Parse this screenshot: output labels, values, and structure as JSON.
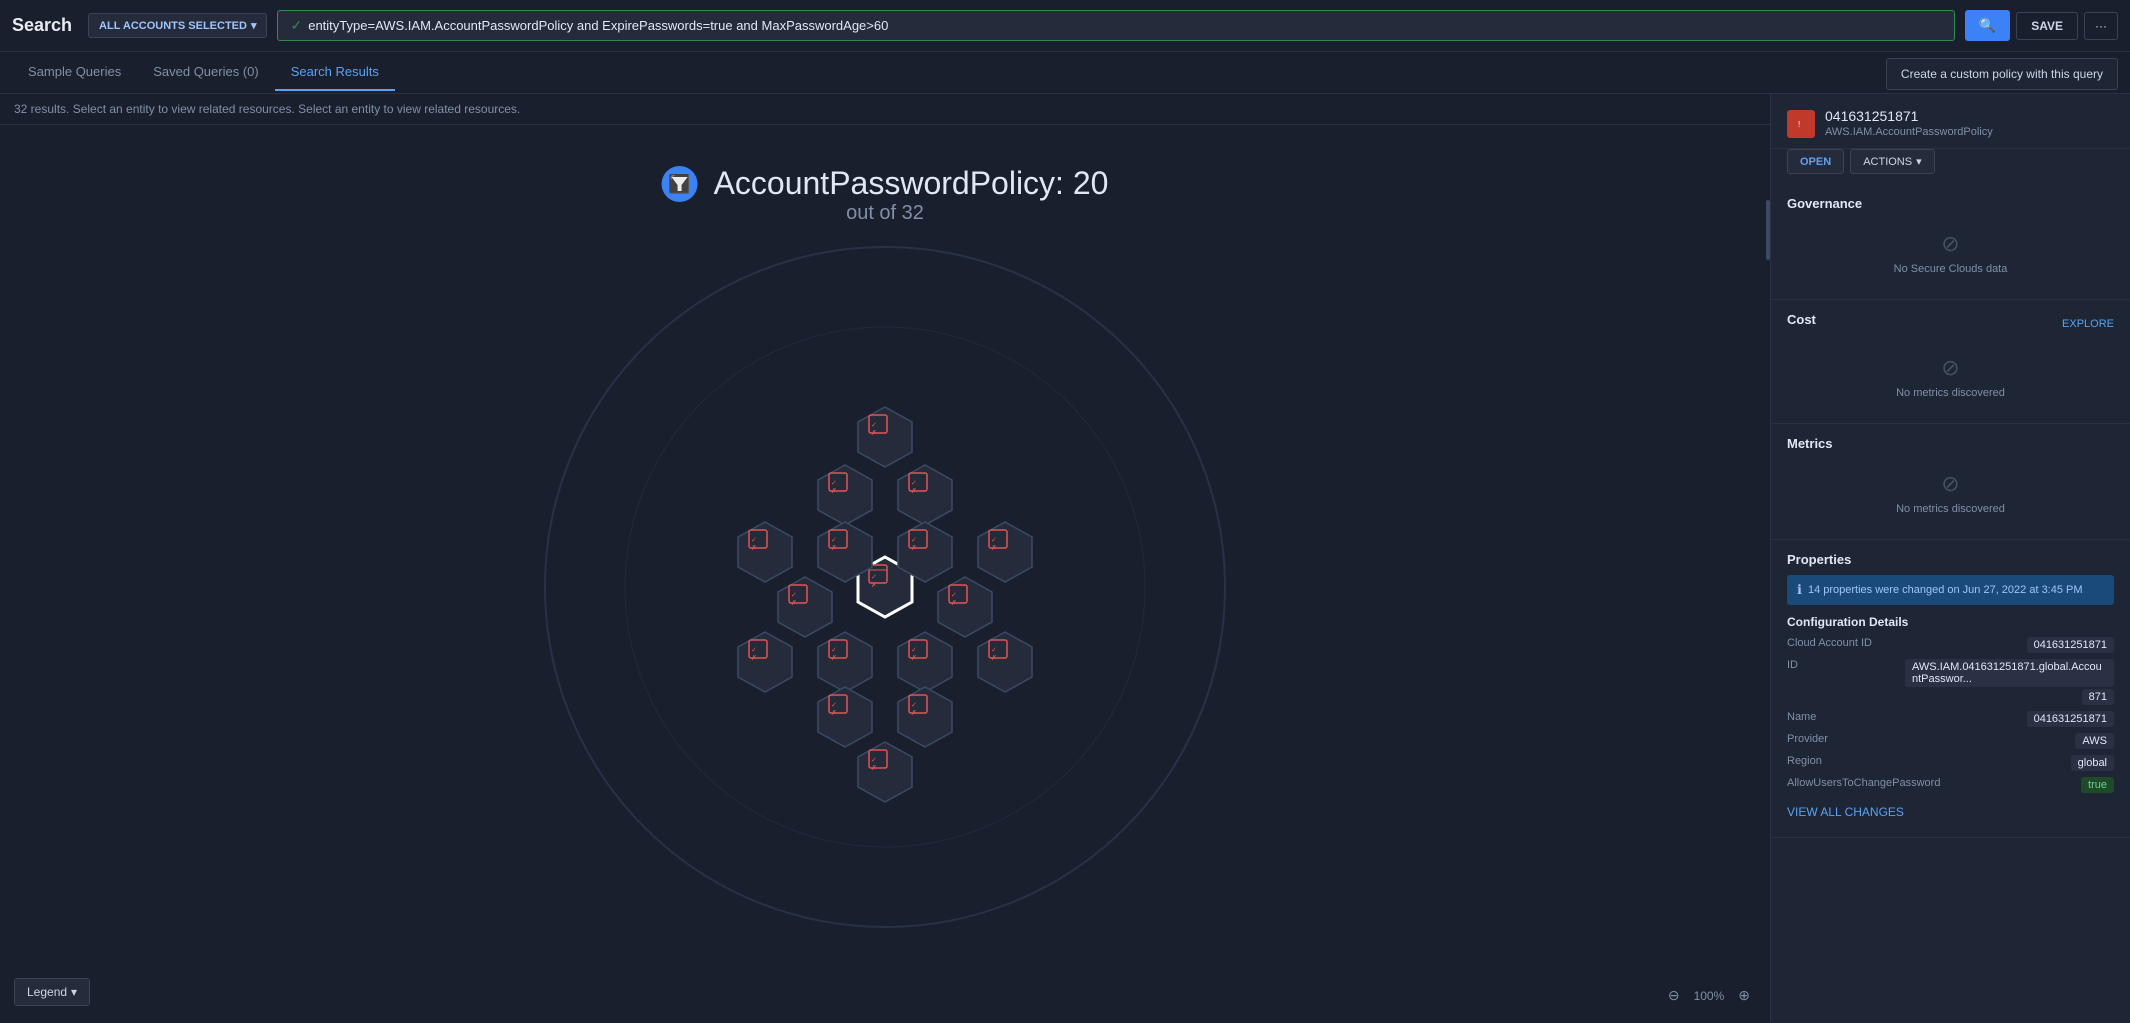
{
  "app": {
    "title": "Search"
  },
  "header": {
    "account_selector": "ALL ACCOUNTS SELECTED",
    "query": "entityType=AWS.IAM.AccountPasswordPolicy and ExpirePasswords=true and MaxPasswordAge>60",
    "save_btn": "SAVE",
    "more_btn": "···"
  },
  "custom_policy_btn": "Create a custom policy with this query",
  "tabs": [
    {
      "label": "Sample Queries",
      "active": false
    },
    {
      "label": "Saved Queries (0)",
      "active": false
    },
    {
      "label": "Search Results",
      "active": true
    }
  ],
  "results": {
    "info": "32 results. Select an entity to view related resources. Select an entity to view related resources."
  },
  "visualization": {
    "title_main": "AccountPasswordPolicy: 20",
    "title_sub": "out of 32"
  },
  "legend_btn": "Legend",
  "zoom": {
    "level": "100%"
  },
  "right_panel": {
    "entity": {
      "id": "041631251871",
      "type": "AWS.IAM.AccountPasswordPolicy",
      "icon_text": "🔴"
    },
    "open_btn": "OPEN",
    "actions_btn": "ACTIONS",
    "sections": {
      "governance": {
        "title": "Governance",
        "no_data": "No Secure Clouds data"
      },
      "cost": {
        "title": "Cost",
        "explore": "EXPLORE",
        "no_data": "No metrics discovered"
      },
      "metrics": {
        "title": "Metrics",
        "no_data": "No metrics discovered"
      },
      "properties": {
        "title": "Properties",
        "info_bar": "14 properties were changed on Jun 27, 2022 at 3:45 PM",
        "config_title": "Configuration Details",
        "fields": [
          {
            "key": "Cloud Account ID",
            "value": "041631251871",
            "style": "tag"
          },
          {
            "key": "ID",
            "value": "AWS.IAM.041631251871.global.AccountPasswor...",
            "style": "tag"
          },
          {
            "key": "",
            "value": "871",
            "style": "tag"
          },
          {
            "key": "Name",
            "value": "041631251871",
            "style": "tag"
          },
          {
            "key": "Provider",
            "value": "AWS",
            "style": "tag"
          },
          {
            "key": "Region",
            "value": "global",
            "style": "tag"
          },
          {
            "key": "AllowUsersToChangePassword",
            "value": "true",
            "style": "green"
          }
        ],
        "view_changes": "VIEW ALL CHANGES"
      }
    }
  }
}
